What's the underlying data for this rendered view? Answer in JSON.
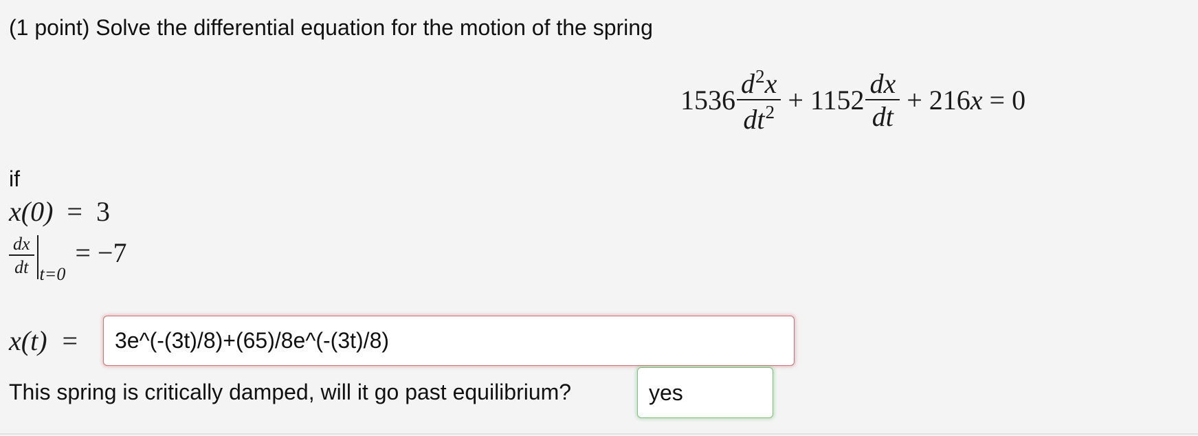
{
  "problem": {
    "prompt": "(1 point) Solve the differential equation for the motion of the spring",
    "equation": {
      "c2": "1536",
      "d2x": "d",
      "d2x_exp": "2",
      "d2x_var": "x",
      "dt2": "dt",
      "dt2_exp": "2",
      "plus1": "+",
      "c1": "1152",
      "dx": "dx",
      "dt": "dt",
      "plus2": "+",
      "c0": "216",
      "x": "x",
      "eq": "=",
      "rhs": "0"
    },
    "if_label": "if",
    "condition1": {
      "lhs": "x(0)",
      "eq": "=",
      "rhs": "3"
    },
    "condition2": {
      "num": "dx",
      "den": "dt",
      "at": "t=0",
      "eq": "=",
      "rhs": "−7"
    }
  },
  "answer1": {
    "label": "x(t)",
    "eq": "=",
    "value": "3e^(-(3t)/8)+(65)/8e^(-(3t)/8)",
    "status_color": "#c9737a"
  },
  "question2": {
    "text": "This spring is critically damped, will it go past equilibrium?",
    "value": "yes",
    "status_color": "#7cbf7c"
  }
}
